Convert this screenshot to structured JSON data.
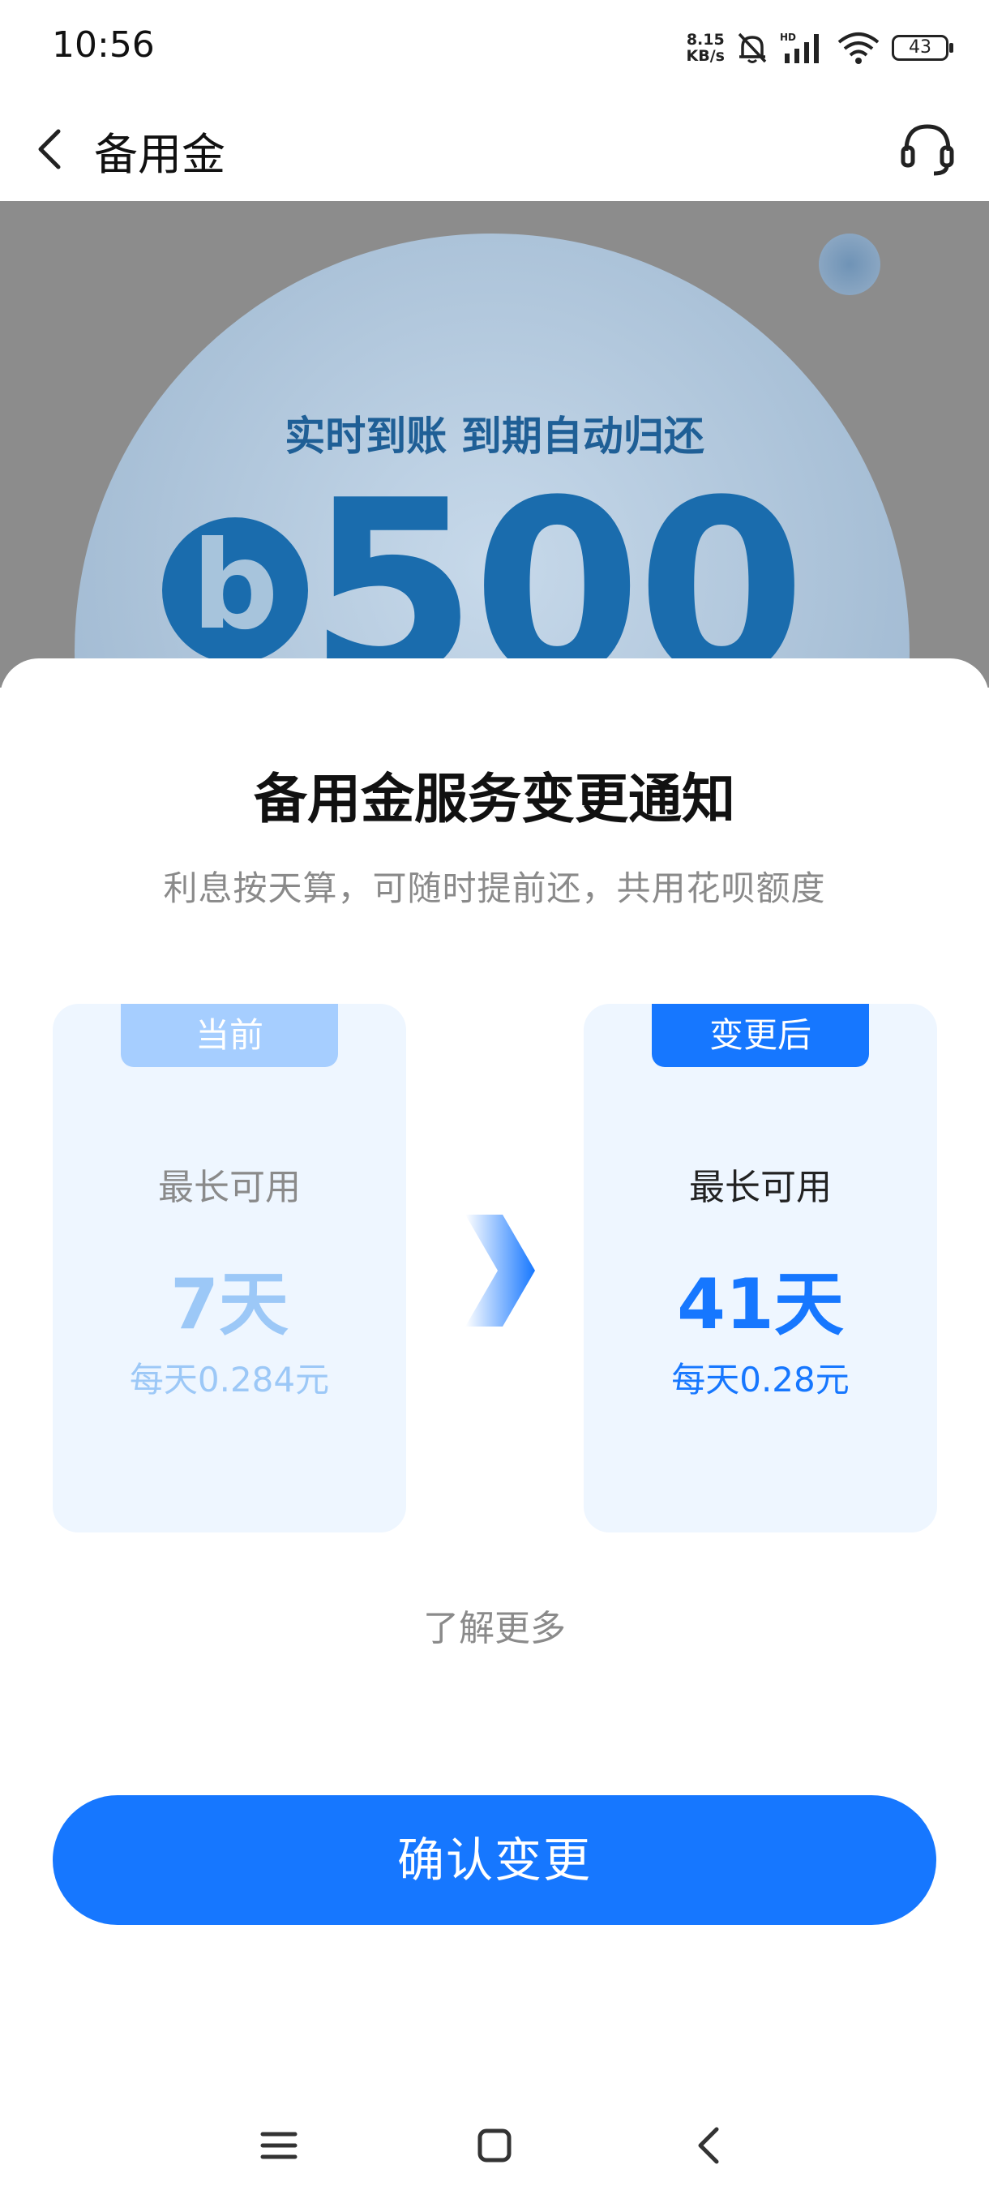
{
  "status_bar": {
    "time": "10:56",
    "net_speed_top": "8.15",
    "net_speed_bottom": "KB/s",
    "battery": "43"
  },
  "nav": {
    "title": "备用金",
    "back_icon": "chevron-left-icon",
    "service_icon": "headset-icon"
  },
  "banner": {
    "slogan": "实时到账 到期自动归还",
    "logo_letter": "b",
    "amount": "500"
  },
  "sheet": {
    "title": "备用金服务变更通知",
    "subtitle": "利息按天算，可随时提前还，共用花呗额度",
    "current": {
      "tag": "当前",
      "label": "最长可用",
      "days": "7天",
      "rate": "每天0.284元"
    },
    "after": {
      "tag": "变更后",
      "label": "最长可用",
      "days": "41天",
      "rate": "每天0.28元"
    },
    "arrow_icon": "arrow-right-icon",
    "learn_more": "了解更多",
    "confirm_label": "确认变更"
  },
  "system_nav": {
    "menu_icon": "menu-icon",
    "home_icon": "home-icon",
    "back_icon": "back-icon"
  },
  "colors": {
    "accent": "#1677ff",
    "accent_light": "#a6ceff",
    "card_bg": "#eef6ff"
  }
}
